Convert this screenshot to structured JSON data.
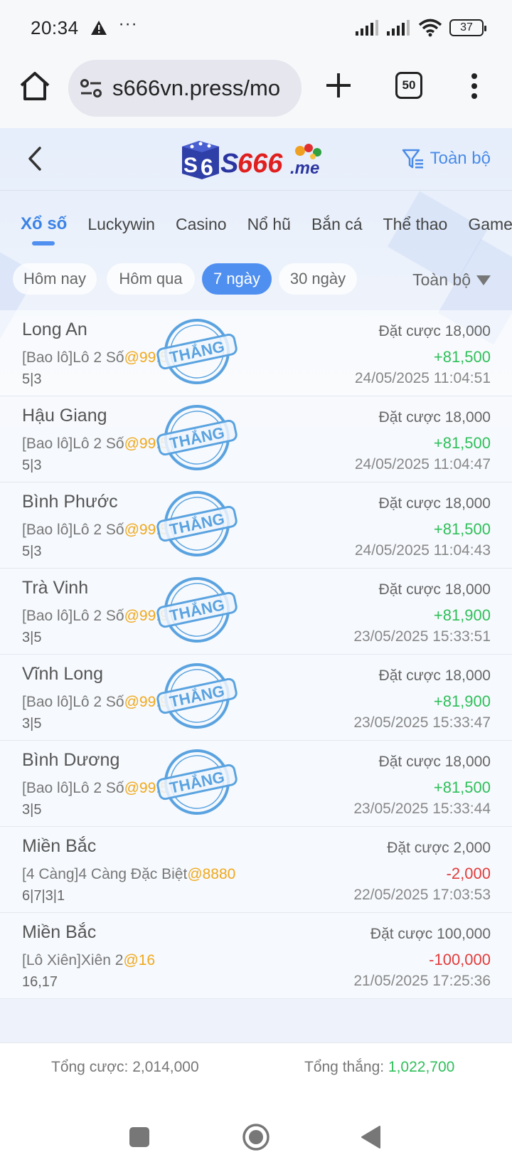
{
  "status_bar": {
    "time": "20:34",
    "dots": "···",
    "battery": "37",
    "icons": [
      "warning-icon",
      "signal-icon",
      "wifi-icon",
      "battery-icon"
    ]
  },
  "browser": {
    "url": "s666vn.press/mo",
    "tab_count": "50",
    "icons": [
      "home-icon",
      "site-settings-icon",
      "plus-icon",
      "tabs-icon",
      "menu-icon"
    ]
  },
  "app": {
    "logo_text": "S666.me",
    "filter_label": "Toàn bộ",
    "categories": [
      {
        "label": "Xổ số",
        "active": true
      },
      {
        "label": "Luckywin",
        "active": false
      },
      {
        "label": "Casino",
        "active": false
      },
      {
        "label": "Nổ hũ",
        "active": false
      },
      {
        "label": "Bắn cá",
        "active": false
      },
      {
        "label": "Thể thao",
        "active": false
      },
      {
        "label": "Game",
        "active": false
      }
    ],
    "date_filters": [
      {
        "label": "Hôm nay",
        "active": false
      },
      {
        "label": "Hôm qua",
        "active": false
      },
      {
        "label": "7 ngày",
        "active": true
      },
      {
        "label": "30 ngày",
        "active": false
      }
    ],
    "date_all_label": "Toàn bộ",
    "stamp_text": "THẮNG",
    "bets": [
      {
        "name": "Long An",
        "type": "[Bao lô]Lô 2 Số",
        "odds": "@99.5",
        "numbers": "5|3",
        "stake": "Đặt cược 18,000",
        "result": "+81,500",
        "win": true,
        "time": "24/05/2025 11:04:51"
      },
      {
        "name": "Hậu Giang",
        "type": "[Bao lô]Lô 2 Số",
        "odds": "@99.5",
        "numbers": "5|3",
        "stake": "Đặt cược 18,000",
        "result": "+81,500",
        "win": true,
        "time": "24/05/2025 11:04:47"
      },
      {
        "name": "Bình Phước",
        "type": "[Bao lô]Lô 2 Số",
        "odds": "@99.5",
        "numbers": "5|3",
        "stake": "Đặt cược 18,000",
        "result": "+81,500",
        "win": true,
        "time": "24/05/2025 11:04:43"
      },
      {
        "name": "Trà Vinh",
        "type": "[Bao lô]Lô 2 Số",
        "odds": "@99.9",
        "numbers": "3|5",
        "stake": "Đặt cược 18,000",
        "result": "+81,900",
        "win": true,
        "time": "23/05/2025 15:33:51"
      },
      {
        "name": "Vĩnh Long",
        "type": "[Bao lô]Lô 2 Số",
        "odds": "@99.9",
        "numbers": "3|5",
        "stake": "Đặt cược 18,000",
        "result": "+81,900",
        "win": true,
        "time": "23/05/2025 15:33:47"
      },
      {
        "name": "Bình Dương",
        "type": "[Bao lô]Lô 2 Số",
        "odds": "@99.5",
        "numbers": "3|5",
        "stake": "Đặt cược 18,000",
        "result": "+81,500",
        "win": true,
        "time": "23/05/2025 15:33:44"
      },
      {
        "name": "Miền Bắc",
        "type": "[4 Càng]4 Càng Đặc Biệt",
        "odds": "@8880",
        "numbers": "6|7|3|1",
        "stake": "Đặt cược 2,000",
        "result": "-2,000",
        "win": false,
        "time": "22/05/2025 17:03:53"
      },
      {
        "name": "Miền Bắc",
        "type": "[Lô Xiên]Xiên 2",
        "odds": "@16",
        "numbers": "16,17",
        "stake": "Đặt cược 100,000",
        "result": "-100,000",
        "win": false,
        "time": "21/05/2025 17:25:36"
      }
    ],
    "footer": {
      "total_bet": "Tổng cược: 2,014,000",
      "total_win_label": "Tổng thắng: ",
      "total_win_value": "1,022,700"
    }
  },
  "colors": {
    "accent": "#4f8ff0",
    "win": "#2fbf5a",
    "loss": "#e23c3c",
    "odds": "#f0a91e"
  }
}
